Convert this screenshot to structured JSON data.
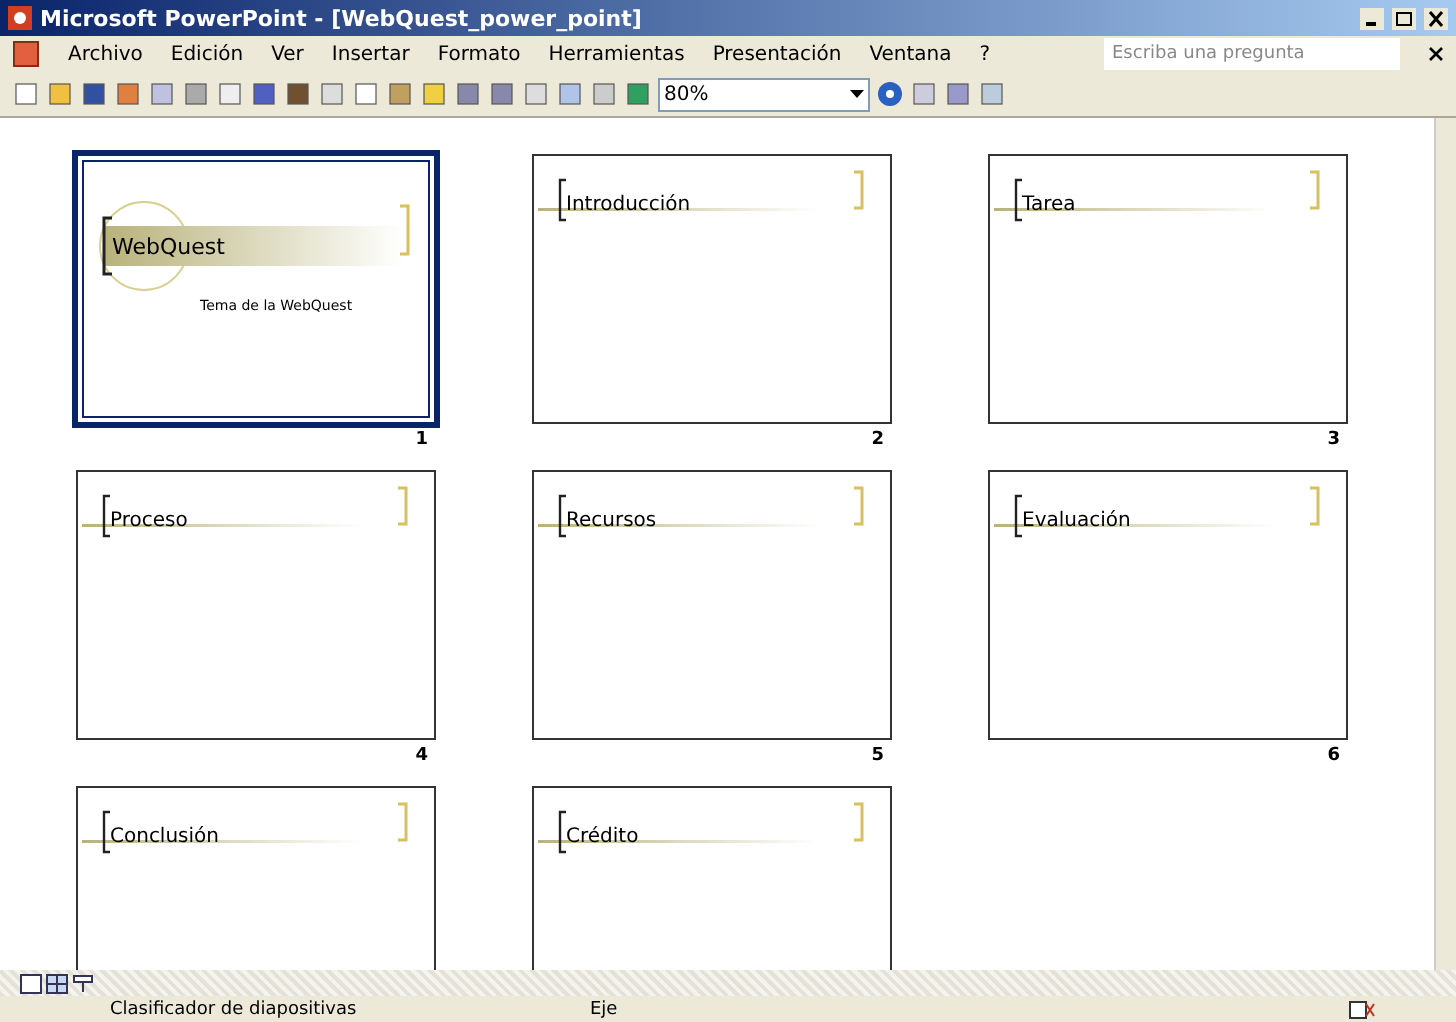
{
  "window": {
    "title": "Microsoft PowerPoint - [WebQuest_power_point]"
  },
  "menu": [
    "Archivo",
    "Edición",
    "Ver",
    "Insertar",
    "Formato",
    "Herramientas",
    "Presentación",
    "Ventana",
    "?"
  ],
  "help_box": {
    "placeholder": "Escriba una pregunta"
  },
  "toolbar": {
    "zoom": "80%"
  },
  "slides": [
    {
      "kind": "title",
      "title": "WebQuest",
      "subtitle": "Tema de la WebQuest",
      "number": "1",
      "selected": true
    },
    {
      "kind": "content",
      "title": "Introducción",
      "number": "2",
      "selected": false
    },
    {
      "kind": "content",
      "title": "Tarea",
      "number": "3",
      "selected": false
    },
    {
      "kind": "content",
      "title": "Proceso",
      "number": "4",
      "selected": false
    },
    {
      "kind": "content",
      "title": "Recursos",
      "number": "5",
      "selected": false
    },
    {
      "kind": "content",
      "title": "Evaluación",
      "number": "6",
      "selected": false
    },
    {
      "kind": "content",
      "title": "Conclusión",
      "selected": false
    },
    {
      "kind": "content",
      "title": "Crédito",
      "selected": false
    }
  ],
  "status_bar": [
    "Clasificador de diapositivas",
    "Eje"
  ]
}
